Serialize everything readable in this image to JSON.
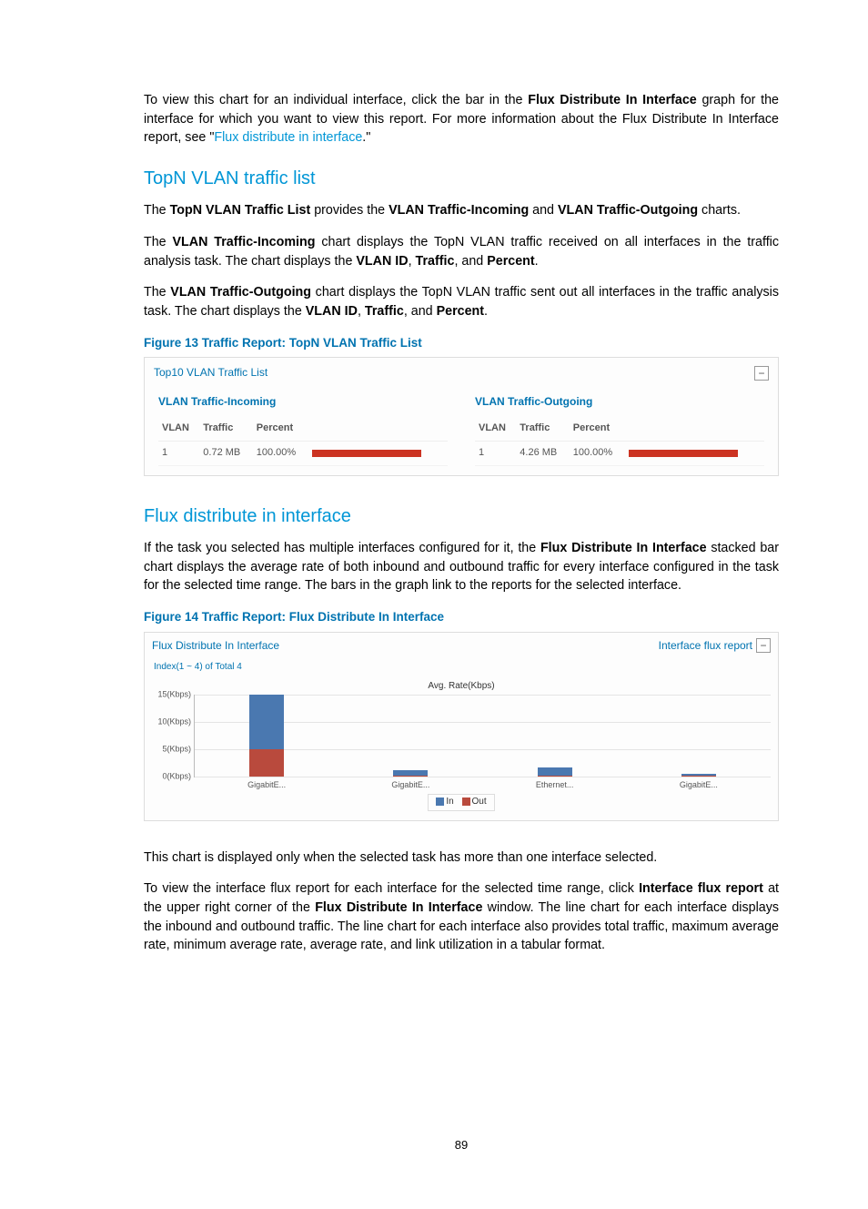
{
  "intro": {
    "p1a": "To view this chart for an individual interface, click the bar in the ",
    "p1b": "Flux Distribute In Interface",
    "p1c": " graph for the interface for which you want to view this report. For more information about the Flux Distribute In Interface report, see \"",
    "p1link": "Flux distribute in interface",
    "p1d": ".\""
  },
  "sec1": {
    "heading": "TopN VLAN traffic list",
    "p1a": "The ",
    "p1b": "TopN VLAN Traffic List",
    "p1c": " provides the ",
    "p1d": "VLAN Traffic-Incoming",
    "p1e": " and ",
    "p1f": "VLAN Traffic-Outgoing",
    "p1g": " charts.",
    "p2a": "The ",
    "p2b": "VLAN Traffic-Incoming",
    "p2c": " chart displays the TopN VLAN traffic received on all interfaces in the traffic analysis task. The chart displays the ",
    "p2d": "VLAN ID",
    "p2e": ", ",
    "p2f": "Traffic",
    "p2g": ", and ",
    "p2h": "Percent",
    "p2i": ".",
    "p3a": "The ",
    "p3b": "VLAN Traffic-Outgoing",
    "p3c": " chart displays the TopN VLAN traffic sent out all interfaces in the traffic analysis task. The chart displays the ",
    "p3d": "VLAN ID",
    "p3e": ", ",
    "p3f": "Traffic",
    "p3g": ", and ",
    "p3h": "Percent",
    "p3i": "."
  },
  "fig13": {
    "caption": "Figure 13 Traffic Report: TopN VLAN Traffic List",
    "panel_title": "Top10 VLAN Traffic List",
    "incoming_title": "VLAN Traffic-Incoming",
    "outgoing_title": "VLAN Traffic-Outgoing",
    "col_vlan": "VLAN",
    "col_traffic": "Traffic",
    "col_percent": "Percent",
    "in_vlan": "1",
    "in_traffic": "0.72 MB",
    "in_percent": "100.00%",
    "out_vlan": "1",
    "out_traffic": "4.26 MB",
    "out_percent": "100.00%"
  },
  "sec2": {
    "heading": "Flux distribute in interface",
    "p1a": "If the task you selected has multiple interfaces configured for it, the ",
    "p1b": "Flux Distribute In Interface",
    "p1c": " stacked bar chart displays the average rate of both inbound and outbound traffic for every interface configured in the task for the selected time range. The bars in the graph link to the reports for the selected interface."
  },
  "fig14": {
    "caption": "Figure 14 Traffic Report: Flux Distribute In Interface",
    "panel_title": "Flux Distribute In Interface",
    "report_link": "Interface flux report",
    "index_text": "Index(1 ~ 4) of Total 4",
    "chart_title": "Avg. Rate(Kbps)",
    "legend_in": "In",
    "legend_out": "Out"
  },
  "followup": {
    "p1": "This chart is displayed only when the selected task has more than one interface selected.",
    "p2a": "To view the interface flux report for each interface for the selected time range, click ",
    "p2b": "Interface flux report",
    "p2c": " at the upper right corner of the ",
    "p2d": "Flux Distribute In Interface",
    "p2e": " window. The line chart for each interface displays the inbound and outbound traffic. The line chart for each interface also provides total traffic, maximum average rate, minimum average rate, average rate, and link utilization in a tabular format."
  },
  "page_number": "89",
  "chart_data": {
    "type": "bar",
    "title": "Avg. Rate(Kbps)",
    "ylabel": "Kbps",
    "ylim": [
      0,
      15
    ],
    "yticks": [
      "0(Kbps)",
      "5(Kbps)",
      "10(Kbps)",
      "15(Kbps)"
    ],
    "categories": [
      "GigabitE...",
      "GigabitE...",
      "Ethernet...",
      "GigabitE..."
    ],
    "series": [
      {
        "name": "In",
        "values": [
          10,
          1,
          1.5,
          0.4
        ]
      },
      {
        "name": "Out",
        "values": [
          5,
          0.2,
          0.2,
          0.1
        ]
      }
    ],
    "legend_position": "bottom"
  }
}
